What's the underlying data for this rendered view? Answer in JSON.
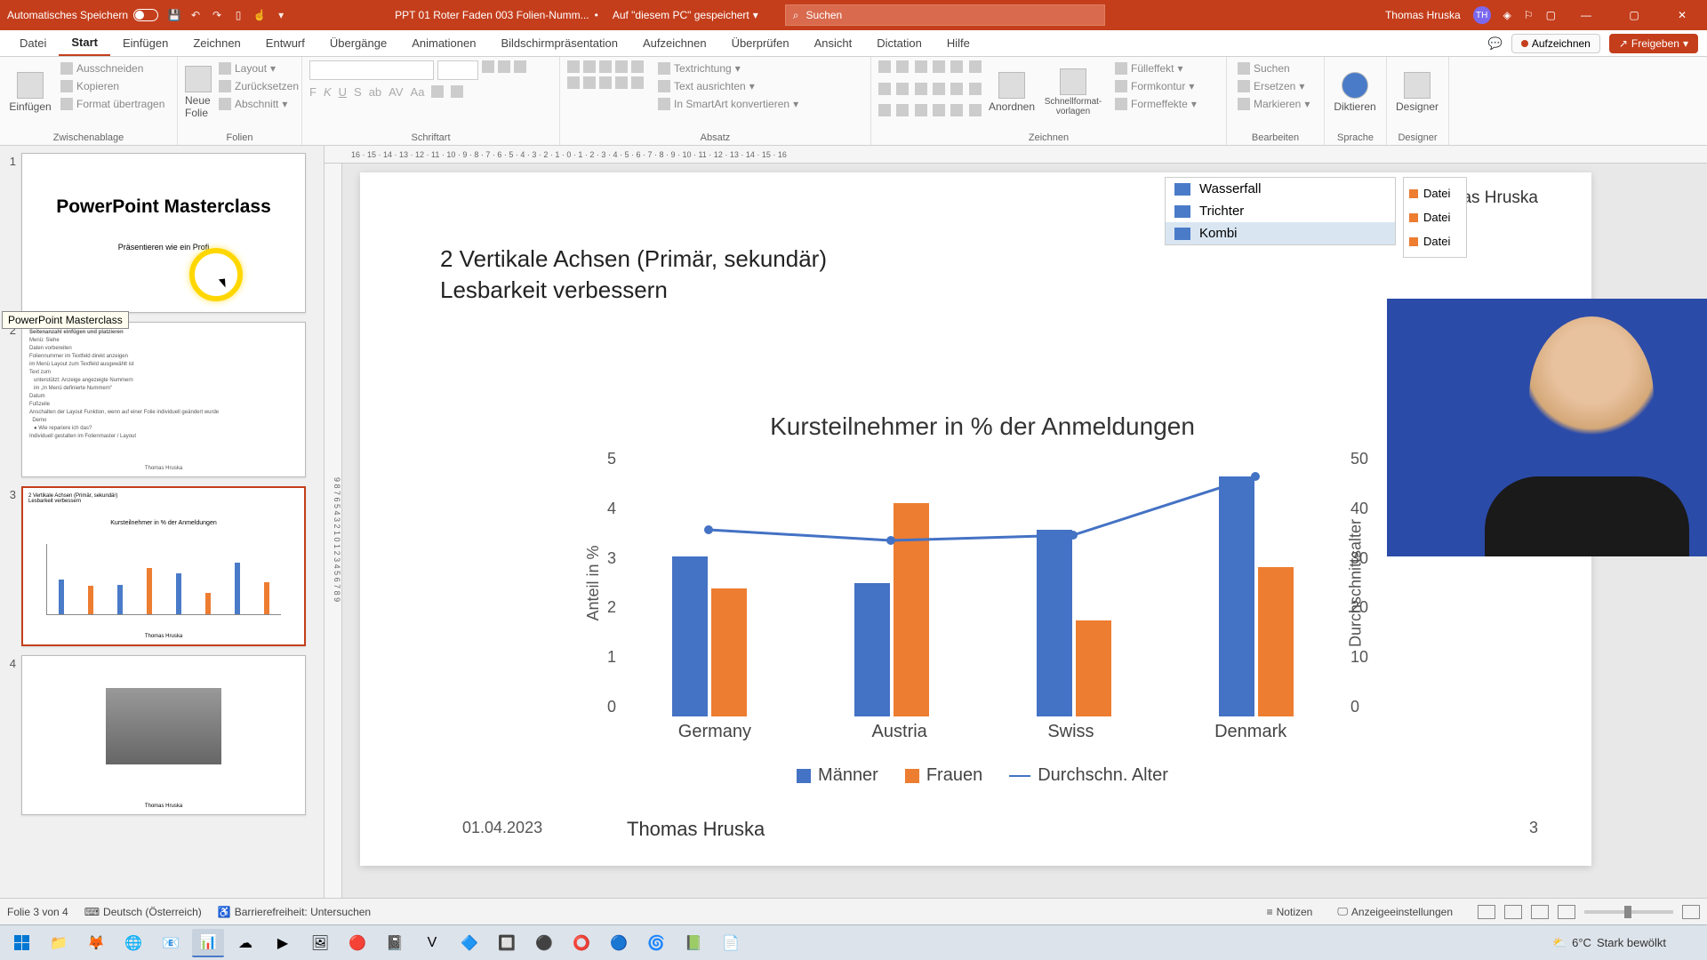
{
  "titlebar": {
    "autosave": "Automatisches Speichern",
    "filename": "PPT 01 Roter Faden 003 Folien-Numm...",
    "saved_location": "Auf \"diesem PC\" gespeichert",
    "search_placeholder": "Suchen",
    "user_name": "Thomas Hruska",
    "user_initials": "TH"
  },
  "ribbon_tabs": [
    "Datei",
    "Start",
    "Einfügen",
    "Zeichnen",
    "Entwurf",
    "Übergänge",
    "Animationen",
    "Bildschirmpräsentation",
    "Aufzeichnen",
    "Überprüfen",
    "Ansicht",
    "Dictation",
    "Hilfe"
  ],
  "ribbon_right": {
    "record": "Aufzeichnen",
    "share": "Freigeben"
  },
  "ribbon_groups": {
    "clipboard": {
      "label": "Zwischenablage",
      "paste": "Einfügen",
      "cut": "Ausschneiden",
      "copy": "Kopieren",
      "format": "Format übertragen"
    },
    "slides": {
      "label": "Folien",
      "new_slide": "Neue Folie",
      "layout": "Layout",
      "reset": "Zurücksetzen",
      "section": "Abschnitt"
    },
    "font": {
      "label": "Schriftart"
    },
    "paragraph": {
      "label": "Absatz",
      "textdir": "Textrichtung",
      "align": "Text ausrichten",
      "smartart": "In SmartArt konvertieren"
    },
    "drawing": {
      "label": "Zeichnen",
      "arrange": "Anordnen",
      "quickstyles": "Schnellformat-vorlagen",
      "fill": "Fülleffekt",
      "outline": "Formkontur",
      "effects": "Formeffekte"
    },
    "editing": {
      "label": "Bearbeiten",
      "find": "Suchen",
      "replace": "Ersetzen",
      "select": "Markieren"
    },
    "voice": {
      "label": "Sprache",
      "dictate": "Diktieren"
    },
    "designer": {
      "label": "Designer",
      "btn": "Designer"
    }
  },
  "slides_panel": {
    "tooltip": "PowerPoint Masterclass",
    "slide1": {
      "num": "1",
      "title": "PowerPoint Masterclass",
      "subtitle": "Präsentieren wie ein Profi"
    },
    "slide2": {
      "num": "2",
      "heading": "Seitenanzahl einfügen und platzieren"
    },
    "slide3": {
      "num": "3"
    },
    "slide4": {
      "num": "4"
    }
  },
  "slide_content": {
    "author_top": "Thomas Hruska",
    "line1": "2 Vertikale Achsen (Primär, sekundär)",
    "line2": "Lesbarkeit verbessern",
    "chart_types": {
      "wasserfall": "Wasserfall",
      "trichter": "Trichter",
      "kombi": "Kombi"
    },
    "legend_items": [
      "Datei",
      "Datei",
      "Datei"
    ],
    "footer_date": "01.04.2023",
    "footer_author": "Thomas Hruska",
    "footer_page": "3"
  },
  "chart_data": {
    "type": "bar",
    "title": "Kursteilnehmer in % der Anmeldungen",
    "categories": [
      "Germany",
      "Austria",
      "Swiss",
      "Denmark"
    ],
    "series": [
      {
        "name": "Männer",
        "values": [
          3.0,
          2.5,
          3.5,
          4.5
        ],
        "color": "#4472c4"
      },
      {
        "name": "Frauen",
        "values": [
          2.4,
          4.0,
          1.8,
          2.8
        ],
        "color": "#ed7d31"
      },
      {
        "name": "Durchschn. Alter",
        "values": [
          35,
          33,
          34,
          45
        ],
        "color": "#4472c4",
        "type": "line",
        "axis": "secondary"
      }
    ],
    "ylabel_left": "Anteil in %",
    "ylabel_right": "Durchschnittsalter",
    "ylim_left": [
      0,
      5
    ],
    "ylim_right": [
      0,
      50
    ],
    "yticks_left": [
      "5",
      "4",
      "3",
      "2",
      "1",
      "0"
    ],
    "yticks_right": [
      "50",
      "40",
      "30",
      "20",
      "10",
      "0"
    ]
  },
  "statusbar": {
    "slide_count": "Folie 3 von 4",
    "language": "Deutsch (Österreich)",
    "accessibility": "Barrierefreiheit: Untersuchen",
    "notes": "Notizen",
    "display": "Anzeigeeinstellungen"
  },
  "taskbar": {
    "weather_temp": "6°C",
    "weather_text": "Stark bewölkt"
  }
}
